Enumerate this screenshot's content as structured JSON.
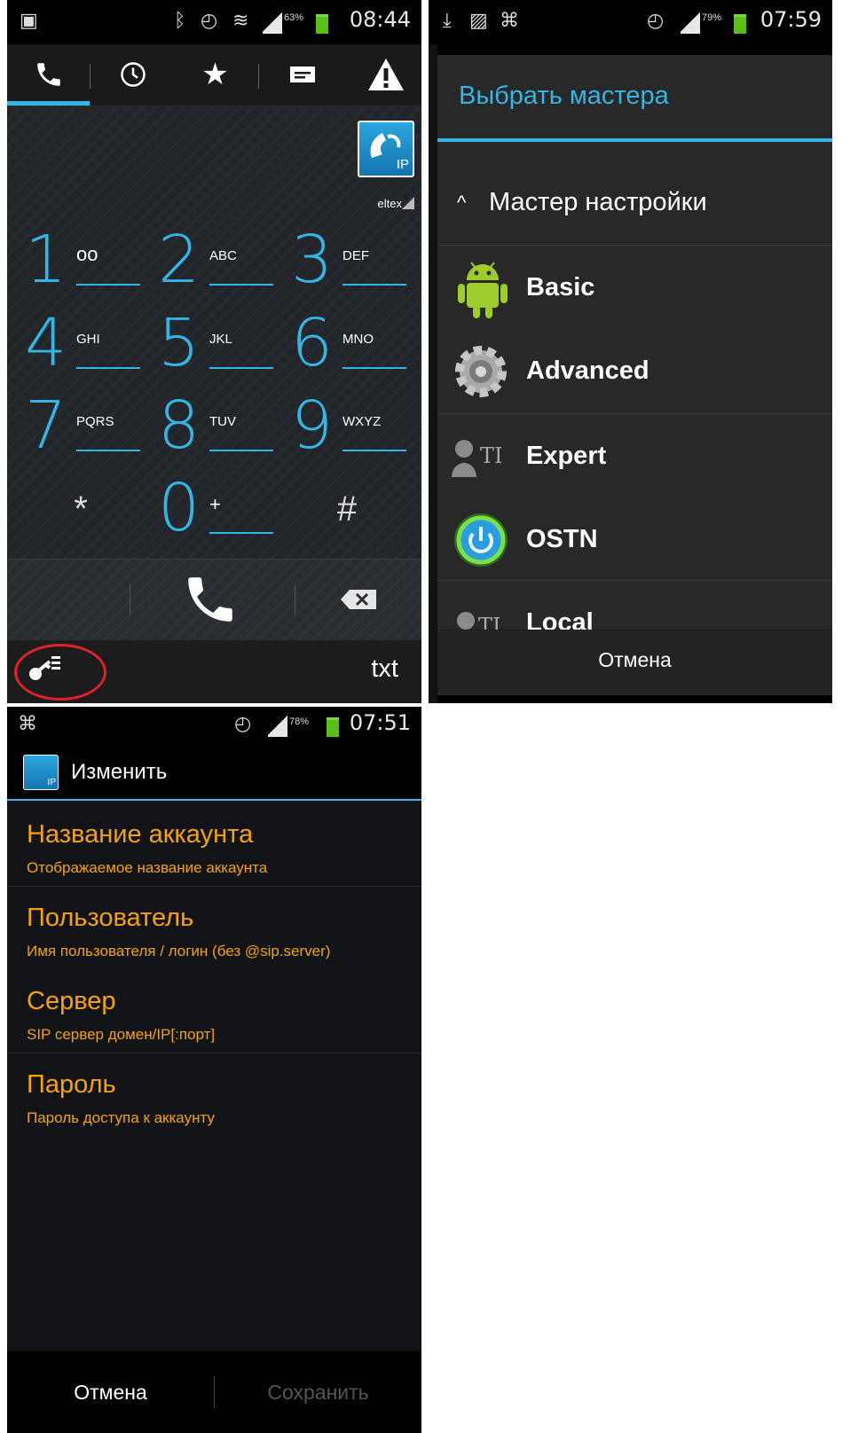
{
  "screen1": {
    "status": {
      "battery": "63%",
      "time": "08:44"
    },
    "tabs": [
      "phone-icon",
      "clock-icon",
      "star-icon",
      "message-icon",
      "warning-icon"
    ],
    "brand": "eltex",
    "keys": [
      {
        "num": "1",
        "letters": "ω"
      },
      {
        "num": "2",
        "letters": "ABC"
      },
      {
        "num": "3",
        "letters": "DEF"
      },
      {
        "num": "4",
        "letters": "GHI"
      },
      {
        "num": "5",
        "letters": "JKL"
      },
      {
        "num": "6",
        "letters": "MNO"
      },
      {
        "num": "7",
        "letters": "PQRS"
      },
      {
        "num": "8",
        "letters": "TUV"
      },
      {
        "num": "9",
        "letters": "WXYZ"
      },
      {
        "num": "*",
        "letters": ""
      },
      {
        "num": "0",
        "letters": "+"
      },
      {
        "num": "#",
        "letters": ""
      }
    ],
    "txt_label": "txt"
  },
  "screen2": {
    "status": {
      "battery": "79%",
      "time": "07:59"
    },
    "title": "Выбрать мастера",
    "section": "Мастер настройки",
    "items": [
      "Basic",
      "Advanced",
      "Expert",
      "OSTN",
      "Local"
    ],
    "cancel": "Отмена"
  },
  "screen3": {
    "status": {
      "battery": "78%",
      "time": "07:51"
    },
    "title": "Изменить",
    "prefs": [
      {
        "title": "Название аккаунта",
        "subtitle": "Отображаемое название аккаунта"
      },
      {
        "title": "Пользователь",
        "subtitle": "Имя пользователя / логин (без @sip.server)"
      },
      {
        "title": "Сервер",
        "subtitle": "SIP сервер домен/IP[:порт]"
      },
      {
        "title": "Пароль",
        "subtitle": "Пароль доступа к аккаунту"
      }
    ],
    "cancel": "Отмена",
    "save": "Сохранить"
  },
  "colors": {
    "accent": "#33b5e5",
    "orange": "#f5a300",
    "annotation": "#e0202a"
  }
}
